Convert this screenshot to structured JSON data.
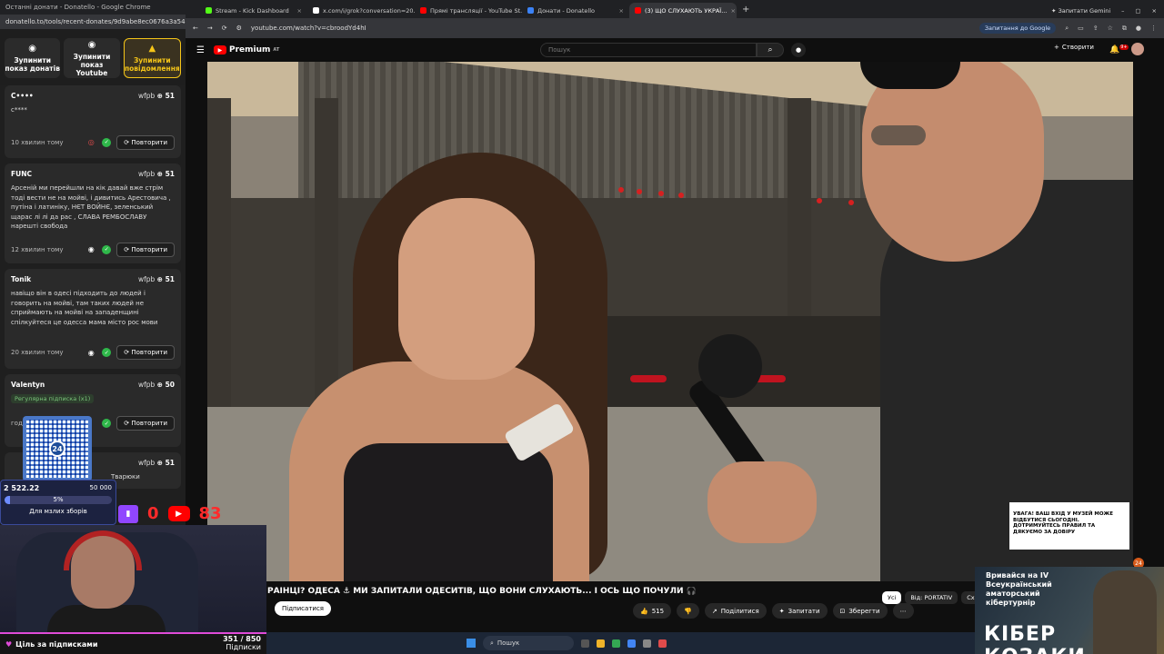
{
  "left_window": {
    "title": "Останні донати - Donatello - Google Chrome",
    "url": "donatello.to/tools/recent-donates/9d9abe8ec0676a3a5412...",
    "buttons": [
      {
        "label": "Зупинити показ донатів",
        "icon": "radio-icon"
      },
      {
        "label": "Зупинити показ Youtube",
        "icon": "radio-icon"
      },
      {
        "label": "Зупинити повідомлення",
        "icon": "warning-icon"
      }
    ],
    "repeat_label": "Повторити",
    "donations": [
      {
        "name": "C••••",
        "platform": "wfpb",
        "amount": "51",
        "message": "c****",
        "time": "10 хвилин тому",
        "tag": ""
      },
      {
        "name": "FUNC",
        "platform": "wfpb",
        "amount": "51",
        "message": "Арсеній ми перейшли на кік давай вже стрім тоді вести не на мойві, і дивитись Арестовича , путіна і латиніку, НЄТ ВОЙНЄ, зеленський щарас лі лі да рас , СЛАВА РЕМБОСЛАВУ нарешті свобода",
        "time": "12 хвилин тому",
        "tag": ""
      },
      {
        "name": "Tonik",
        "platform": "wfpb",
        "amount": "51",
        "message": "навіщо він в одесі підходить до людей і говорить на мойві, там таких людей не сприймають на мойві на западенщині спілкуйтеся це одесса мама місто рос мови",
        "time": "20 хвилин тому",
        "tag": ""
      },
      {
        "name": "Valentyn",
        "platform": "wfpb",
        "amount": "50",
        "message": "",
        "time": "год",
        "tag": "Регулярна підписка (x1)"
      },
      {
        "name": "",
        "platform": "wfpb",
        "amount": "51",
        "message": "Тварюки",
        "time": "",
        "tag": ""
      }
    ]
  },
  "overlay": {
    "qr_number": "24",
    "goal_current": "2 522.22",
    "goal_target": "50 000",
    "goal_percent_label": "5%",
    "goal_fraction": 0.05,
    "goal_label": "Для мзлих зборів",
    "twitch_count": "0",
    "youtube_count": "83",
    "sub_goal_label": "Ціль за підписками",
    "sub_goal_count": "351 / 850",
    "sub_goal_unit": "Підписки"
  },
  "right_window": {
    "tabs": [
      {
        "label": "Stream - Kick Dashboard",
        "color": "#53fc18"
      },
      {
        "label": "x.com/i/grok?conversation=20...",
        "color": "#ffffff"
      },
      {
        "label": "Прямі трансляції - YouTube St...",
        "color": "#ff0000"
      },
      {
        "label": "Донати - Donatello",
        "color": "#3b82f6"
      },
      {
        "label": "(3) ЩО СЛУХАЮТЬ УКРАЇ...",
        "color": "#ff0000",
        "active": true
      }
    ],
    "gemini_label": "Запитати Gemini",
    "url": "youtube.com/watch?v=cbroodYd4hI",
    "google_pill": "Запитання до Google"
  },
  "youtube": {
    "logo": "Premium",
    "logo_sup": "AT",
    "search_placeholder": "Пошук",
    "create_label": "Створити",
    "bell_count": "9+",
    "video_title": "РАЇНЦІ? ОДЕСА ⚓ МИ ЗАПИТАЛИ ОДЕСИТІВ, ЩО ВОНИ СЛУХАЮТЬ... І ОСЬ ЩО ПОЧУЛИ 🎧",
    "subscribe_label": "Підписатися",
    "likes": "515",
    "share_label": "Поділитися",
    "clip_label": "Запитати",
    "save_label": "Зберегти",
    "chips": [
      "Усі",
      "Від: PORTATIV",
      "Схож"
    ],
    "ad_text": "УВАГА! ВАШ ВХІД У МУЗЕЙ МОЖЕ ВІДБУТИСЯ СЬОГОДНІ. ДОТРИМУЙТЕСЬ ПРАВИЛ ТА ДЯКУЄМО ЗА ДОВІРУ"
  },
  "taskbar": {
    "search_label": "Пошук"
  },
  "promo": {
    "text": "Вривайся на IV Всеукраїнський аматорський кібертурнір",
    "big": "КІБЕР КОЗАКИ",
    "badge": "24"
  }
}
